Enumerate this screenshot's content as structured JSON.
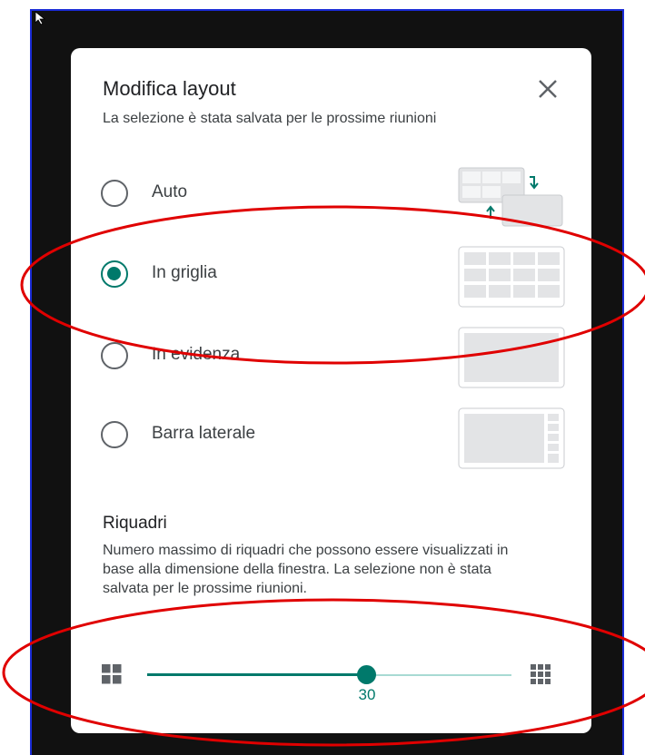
{
  "dialog": {
    "title": "Modifica layout",
    "subtitle": "La selezione è stata salvata per le prossime riunioni",
    "close_icon": "close-icon"
  },
  "layout_options": [
    {
      "label": "Auto",
      "selected": false,
      "icon": "auto-layout-icon"
    },
    {
      "label": "In griglia",
      "selected": true,
      "icon": "grid-layout-icon"
    },
    {
      "label": "In evidenza",
      "selected": false,
      "icon": "spotlight-layout-icon"
    },
    {
      "label": "Barra laterale",
      "selected": false,
      "icon": "sidebar-layout-icon"
    }
  ],
  "tiles": {
    "title": "Riquadri",
    "description": "Numero massimo di riquadri che possono essere visualizzati in base alla dimensione della finestra. La selezione non è stata salvata per le prossime riunioni.",
    "slider_value": "30",
    "min_icon": "few-tiles-icon",
    "max_icon": "many-tiles-icon"
  },
  "colors": {
    "accent": "#00796b",
    "annotation": "#e00000",
    "backdrop": "#111111"
  }
}
